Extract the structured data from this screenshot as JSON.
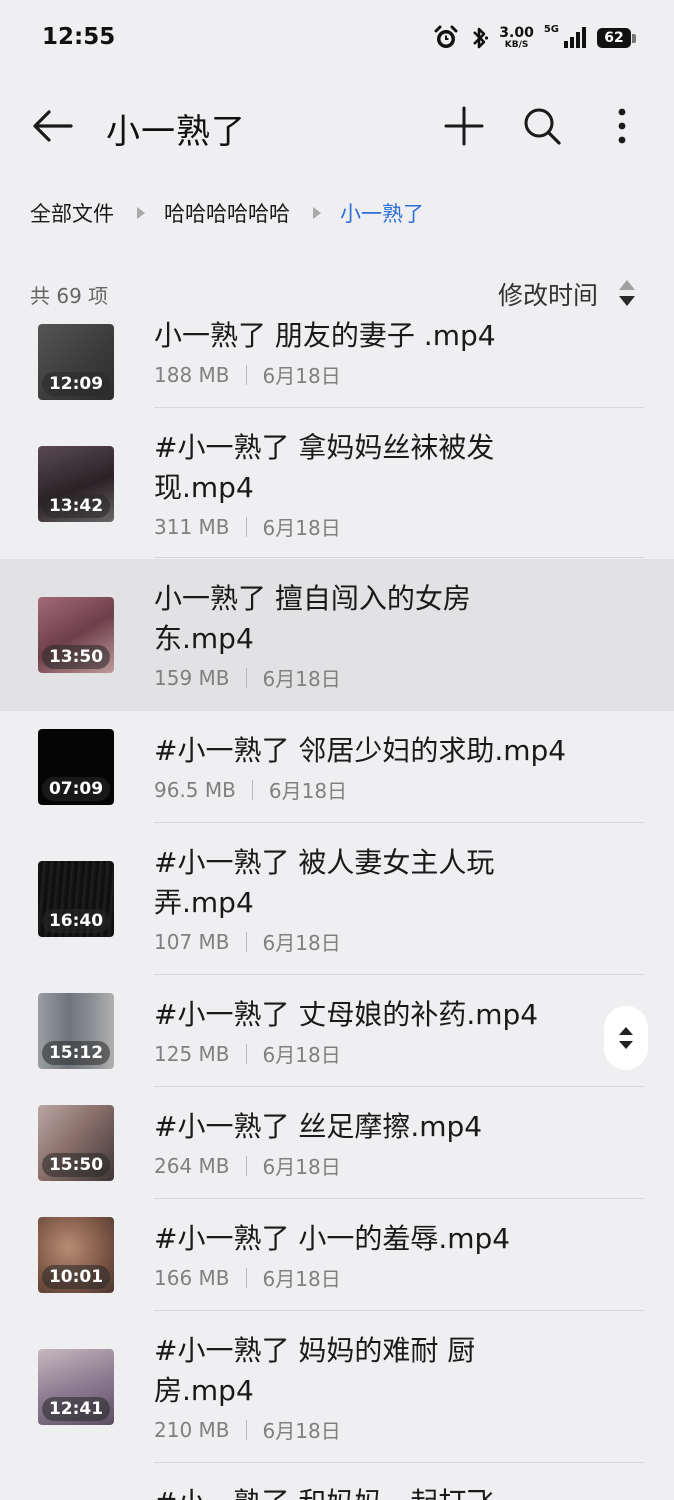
{
  "status": {
    "time": "12:55",
    "net_speed_value": "3.00",
    "net_speed_unit": "KB/S",
    "net_type": "5G",
    "battery": "62"
  },
  "app_bar": {
    "title": "小一熟了"
  },
  "breadcrumb": [
    "全部文件",
    "哈哈哈哈哈哈",
    "小一熟了"
  ],
  "summary": {
    "count": "共 69 项",
    "sort_label": "修改时间"
  },
  "files": [
    {
      "name": "小一熟了 朋友的妻子 .mp4",
      "size": "188 MB",
      "date": "6月18日",
      "duration": "12:09",
      "thumb_color": "#4a4a4a"
    },
    {
      "name": "#小一熟了 拿妈妈丝袜被发现.mp4",
      "size": "311 MB",
      "date": "6月18日",
      "duration": "13:42",
      "thumb_color": "#3b3437"
    },
    {
      "name": "小一熟了 擅自闯入的女房东.mp4",
      "size": "159 MB",
      "date": "6月18日",
      "duration": "13:50",
      "thumb_color": "#8a5560"
    },
    {
      "name": "#小一熟了 邻居少妇的求助.mp4",
      "size": "96.5 MB",
      "date": "6月18日",
      "duration": "07:09",
      "thumb_color": "#050505"
    },
    {
      "name": "#小一熟了 被人妻女主人玩弄.mp4",
      "size": "107 MB",
      "date": "6月18日",
      "duration": "16:40",
      "thumb_color": "#141414"
    },
    {
      "name": "#小一熟了 丈母娘的补药.mp4",
      "size": "125 MB",
      "date": "6月18日",
      "duration": "15:12",
      "thumb_color": "#7e8286"
    },
    {
      "name": "#小一熟了 丝足摩擦.mp4",
      "size": "264 MB",
      "date": "6月18日",
      "duration": "15:50",
      "thumb_color": "#8c7a76"
    },
    {
      "name": "#小一熟了 小一的羞辱.mp4",
      "size": "166 MB",
      "date": "6月18日",
      "duration": "10:01",
      "thumb_color": "#8a6a58"
    },
    {
      "name": "#小一熟了 妈妈的难耐 厨房.mp4",
      "size": "210 MB",
      "date": "6月18日",
      "duration": "12:41",
      "thumb_color": "#8f7f8e"
    },
    {
      "name": "#小一熟了 和妈妈一起打飞",
      "size": "",
      "date": "",
      "duration": "",
      "thumb_color": "#efeff1"
    }
  ],
  "colors": {
    "accent": "#2f6fd8",
    "background": "#efeff1",
    "selected_row": "#e2e2e4"
  },
  "icons": {
    "back": "arrow-left-icon",
    "add": "plus-icon",
    "search": "search-icon",
    "more": "more-vertical-icon",
    "sort": "sort-updown-icon",
    "breadcrumb_sep": "triangle-right-icon"
  }
}
